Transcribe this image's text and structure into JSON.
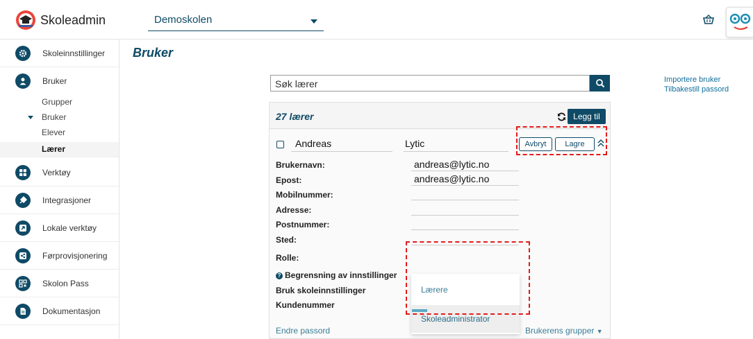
{
  "app": {
    "title": "Skoleadmin"
  },
  "school_selector": {
    "value": "Demoskolen"
  },
  "sidebar": {
    "items": [
      {
        "label": "Skoleinnstillinger",
        "icon": "gear-icon"
      },
      {
        "label": "Bruker",
        "icon": "user-icon"
      },
      {
        "label": "Verktøy",
        "icon": "grid-icon"
      },
      {
        "label": "Integrasjoner",
        "icon": "plug-icon"
      },
      {
        "label": "Lokale verktøy",
        "icon": "external-link-icon"
      },
      {
        "label": "Førprovisjonering",
        "icon": "share-icon"
      },
      {
        "label": "Skolon Pass",
        "icon": "qr-code-icon"
      },
      {
        "label": "Dokumentasjon",
        "icon": "document-icon"
      }
    ],
    "subitems": [
      {
        "label": "Grupper"
      },
      {
        "label": "Bruker"
      },
      {
        "label": "Elever"
      },
      {
        "label": "Lærer"
      }
    ]
  },
  "page": {
    "title": "Bruker"
  },
  "search": {
    "text": "Søk lærer"
  },
  "side_links": {
    "import": "Importere bruker",
    "reset": "Tilbakestill passord"
  },
  "card": {
    "count_label": "27 lærer",
    "add_label": "Legg til",
    "user": {
      "first_name": "Andreas",
      "last_name": "Lytic",
      "cancel_label": "Avbryt",
      "save_label": "Lagre",
      "fields": [
        {
          "label": "Brukernavn:",
          "value": "andreas@lytic.no"
        },
        {
          "label": "Epost:",
          "value": "andreas@lytic.no"
        },
        {
          "label": "Mobilnummer:",
          "value": ""
        },
        {
          "label": "Adresse:",
          "value": ""
        },
        {
          "label": "Postnummer:",
          "value": ""
        },
        {
          "label": "Sted:",
          "value": ""
        }
      ],
      "role_label": "Rolle:",
      "settings_limit_label": "Begrensning av innstillinger",
      "school_settings_label": "Bruk skoleinnstillinger",
      "customer_number_label": "Kundenummer",
      "role_options": [
        "Lærere",
        "Skoleadministrator"
      ]
    },
    "change_password": "Endre passord",
    "user_groups": "Brukerens grupper"
  },
  "colors": {
    "primary": "#0f4a66",
    "link": "#3b7d97",
    "highlight": "#e21b1b"
  }
}
